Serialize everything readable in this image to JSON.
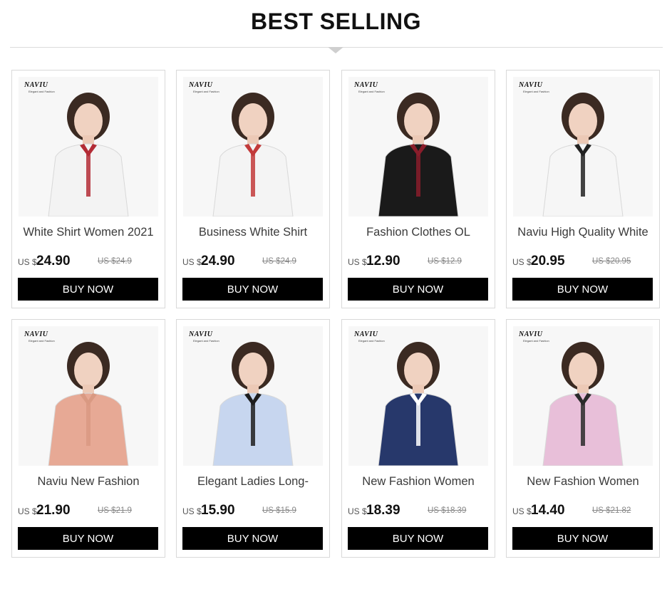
{
  "header": {
    "title": "BEST SELLING"
  },
  "brand": {
    "logo_text": "NAVIU",
    "logo_sub": "Elegant and Fashion"
  },
  "products": [
    {
      "name": "White Shirt Women 2021",
      "currency": "US $",
      "price": "24.90",
      "old_price": "US $24.9",
      "buy_label": "BUY NOW",
      "shirt_color": "#f3f3f3",
      "accent_color": "#b32b35",
      "image_desc": "woman in white shirt with red striped tie"
    },
    {
      "name": "Business White Shirt",
      "currency": "US $",
      "price": "24.90",
      "old_price": "US $24.9",
      "buy_label": "BUY NOW",
      "shirt_color": "#f4f4f4",
      "accent_color": "#c23a3a",
      "image_desc": "woman in white shirt with suspenders and plaid tie"
    },
    {
      "name": "Fashion Clothes OL",
      "currency": "US $",
      "price": "12.90",
      "old_price": "US $12.9",
      "buy_label": "BUY NOW",
      "shirt_color": "#1a1a1a",
      "accent_color": "#8a1d2b",
      "image_desc": "woman in black shirt with red cuffs"
    },
    {
      "name": "Naviu High Quality White",
      "currency": "US $",
      "price": "20.95",
      "old_price": "US $20.95",
      "buy_label": "BUY NOW",
      "shirt_color": "#f6f6f6",
      "accent_color": "#222222",
      "image_desc": "woman in white ruffled blouse"
    },
    {
      "name": "Naviu New Fashion",
      "currency": "US $",
      "price": "21.90",
      "old_price": "US $21.9",
      "buy_label": "BUY NOW",
      "shirt_color": "#e7a995",
      "accent_color": "#d99982",
      "image_desc": "woman in pink bow blouse"
    },
    {
      "name": "Elegant Ladies Long-",
      "currency": "US $",
      "price": "15.90",
      "old_price": "US $15.9",
      "buy_label": "BUY NOW",
      "shirt_color": "#c7d6ef",
      "accent_color": "#1d1d1d",
      "image_desc": "woman in light blue ruffled shirt"
    },
    {
      "name": "New Fashion Women",
      "currency": "US $",
      "price": "18.39",
      "old_price": "US $18.39",
      "buy_label": "BUY NOW",
      "shirt_color": "#27386b",
      "accent_color": "#ffffff",
      "image_desc": "woman in navy shirt with white collar"
    },
    {
      "name": "New Fashion Women",
      "currency": "US $",
      "price": "14.40",
      "old_price": "US $21.82",
      "buy_label": "BUY NOW",
      "shirt_color": "#e8bfd9",
      "accent_color": "#2a2a2a",
      "image_desc": "woman in pink shirt with black tie"
    }
  ]
}
